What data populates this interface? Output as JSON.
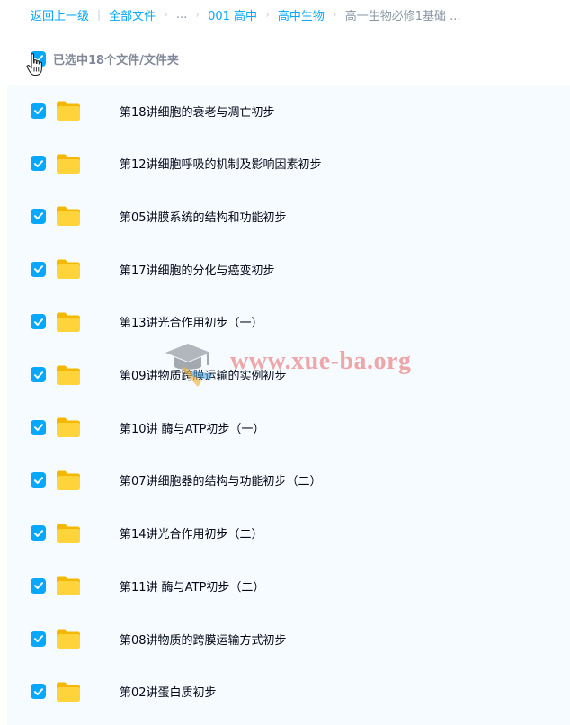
{
  "breadcrumb": {
    "back": "返回上一级",
    "all_files": "全部文件",
    "ellipsis": "...",
    "level1": "001 高中",
    "level2": "高中生物",
    "current": "高一生物必修1基础 ..."
  },
  "selection": {
    "text": "已选中18个文件/文件夹"
  },
  "files": [
    {
      "name": "第18讲细胞的衰老与凋亡初步",
      "checked": true
    },
    {
      "name": "第12讲细胞呼吸的机制及影响因素初步",
      "checked": true
    },
    {
      "name": "第05讲膜系统的结构和功能初步",
      "checked": true
    },
    {
      "name": "第17讲细胞的分化与癌变初步",
      "checked": true
    },
    {
      "name": "第13讲光合作用初步（一）",
      "checked": true
    },
    {
      "name": "第09讲物质跨膜运输的实例初步",
      "checked": true
    },
    {
      "name": "第10讲 酶与ATP初步（一）",
      "checked": true
    },
    {
      "name": "第07讲细胞器的结构与功能初步（二）",
      "checked": true
    },
    {
      "name": "第14讲光合作用初步（二）",
      "checked": true
    },
    {
      "name": "第11讲 酶与ATP初步（二）",
      "checked": true
    },
    {
      "name": "第08讲物质的跨膜运输方式初步",
      "checked": true
    },
    {
      "name": "第02讲蛋白质初步",
      "checked": true
    }
  ],
  "watermark": {
    "text": "www.xue-ba.org"
  },
  "colors": {
    "accent": "#06a7ff",
    "list_background": "#f5fbff",
    "folder": "#ffd43b"
  }
}
